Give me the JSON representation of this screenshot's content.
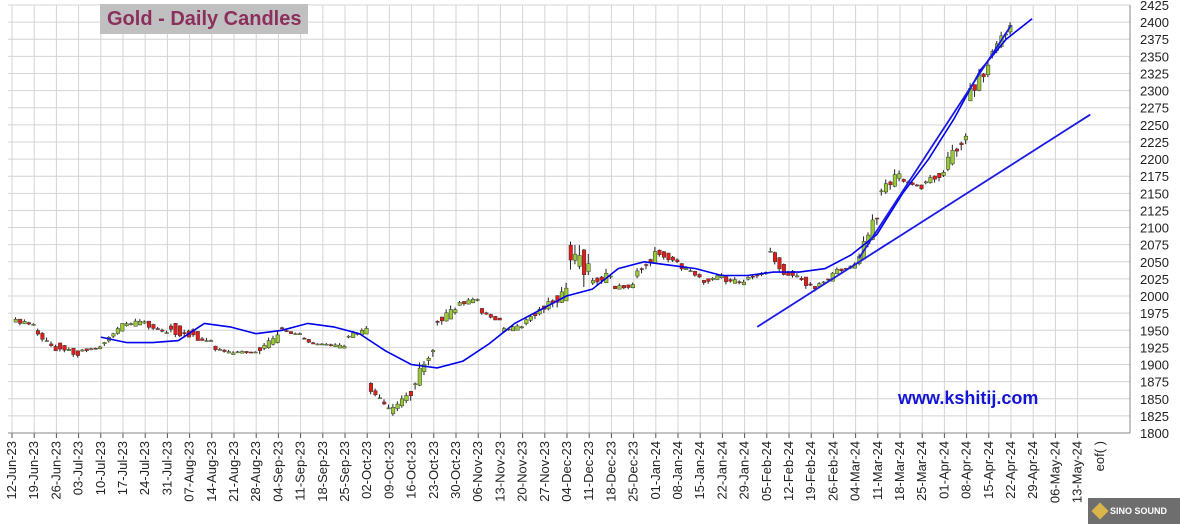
{
  "title": "Gold - Daily Candles",
  "watermark": "www.kshitij.com",
  "badge": "SINO SOUND",
  "eof_label": "eof( )",
  "colors": {
    "up": "#99cc33",
    "down": "#e41b17",
    "ma": "#0000ee",
    "trend": "#1a1ae6",
    "grid": "#d4d4d4"
  },
  "chart_data": {
    "type": "candlestick",
    "title": "Gold - Daily Candles",
    "ylim": [
      1800,
      2425
    ],
    "y_ticks": [
      1800,
      1825,
      1850,
      1875,
      1900,
      1925,
      1950,
      1975,
      2000,
      2025,
      2050,
      2075,
      2100,
      2125,
      2150,
      2175,
      2200,
      2225,
      2250,
      2275,
      2300,
      2325,
      2350,
      2375,
      2400,
      2425
    ],
    "x_ticks": [
      "12-Jun-23",
      "19-Jun-23",
      "26-Jun-23",
      "03-Jul-23",
      "10-Jul-23",
      "17-Jul-23",
      "24-Jul-23",
      "31-Jul-23",
      "07-Aug-23",
      "14-Aug-23",
      "21-Aug-23",
      "28-Aug-23",
      "04-Sep-23",
      "11-Sep-23",
      "18-Sep-23",
      "25-Sep-23",
      "02-Oct-23",
      "09-Oct-23",
      "16-Oct-23",
      "23-Oct-23",
      "30-Oct-23",
      "06-Nov-23",
      "13-Nov-23",
      "20-Nov-23",
      "27-Nov-23",
      "04-Dec-23",
      "11-Dec-23",
      "18-Dec-23",
      "25-Dec-23",
      "01-Jan-24",
      "08-Jan-24",
      "15-Jan-24",
      "22-Jan-24",
      "29-Jan-24",
      "05-Feb-24",
      "12-Feb-24",
      "19-Feb-24",
      "26-Feb-24",
      "04-Mar-24",
      "11-Mar-24",
      "18-Mar-24",
      "25-Mar-24",
      "01-Apr-24",
      "08-Apr-24",
      "15-Apr-24",
      "22-Apr-24",
      "29-Apr-24",
      "06-May-24",
      "13-May-24"
    ],
    "weekly_closes": [
      1958,
      1920,
      1915,
      1925,
      1958,
      1962,
      1945,
      1942,
      1920,
      1915,
      1918,
      1940,
      1935,
      1922,
      1925,
      1950,
      1833,
      1860,
      1925,
      1980,
      1995,
      1962,
      1955,
      1985,
      2005,
      2040,
      2030,
      2015,
      2060,
      2050,
      2028,
      2030,
      2018,
      2035,
      2025,
      2015,
      2030,
      2045,
      2120,
      2178,
      2158,
      2180,
      2235,
      2335,
      2395
    ],
    "weekly_highs": [
      1975,
      1965,
      1935,
      1930,
      1960,
      1985,
      1968,
      2005,
      1975,
      1935,
      1925,
      1965,
      1960,
      1945,
      1945,
      1960,
      1875,
      1890,
      1930,
      2000,
      2010,
      1985,
      1960,
      1990,
      2040,
      2150,
      2050,
      2040,
      2080,
      2075,
      2050,
      2040,
      2045,
      2055,
      2075,
      2040,
      2035,
      2050,
      2120,
      2205,
      2175,
      2200,
      2265,
      2365,
      2410
    ],
    "weekly_lows": [
      1950,
      1920,
      1905,
      1910,
      1925,
      1955,
      1940,
      1940,
      1935,
      1910,
      1910,
      1915,
      1945,
      1930,
      1920,
      1930,
      1830,
      1825,
      1850,
      1950,
      1985,
      1965,
      1935,
      1945,
      1975,
      1990,
      1995,
      2010,
      2020,
      2040,
      2025,
      2010,
      2010,
      2020,
      2030,
      2000,
      2000,
      2025,
      2045,
      2130,
      2155,
      2155,
      2180,
      2285,
      2340
    ],
    "weekly_opens": [
      1965,
      1950,
      1928,
      1920,
      1928,
      1958,
      1960,
      1955,
      1950,
      1925,
      1918,
      1920,
      1955,
      1940,
      1930,
      1940,
      1870,
      1830,
      1865,
      1960,
      1988,
      1980,
      1950,
      1960,
      1985,
      2065,
      2020,
      2012,
      2030,
      2065,
      2045,
      2020,
      2025,
      2025,
      2070,
      2035,
      2010,
      2035,
      2045,
      2150,
      2170,
      2165,
      2190,
      2290,
      2350
    ],
    "moving_average": [
      1940,
      1932,
      1932,
      1935,
      1960,
      1955,
      1945,
      1950,
      1960,
      1955,
      1945,
      1920,
      1900,
      1895,
      1905,
      1930,
      1960,
      1980,
      2000,
      2010,
      2040,
      2050,
      2045,
      2040,
      2030,
      2030,
      2035,
      2035,
      2040,
      2060,
      2090,
      2150,
      2200,
      2260,
      2330,
      2375,
      2405
    ],
    "trendlines": [
      {
        "from": [
          "02-Feb-24",
          1955
        ],
        "to": [
          "17-May-24",
          2265
        ]
      },
      {
        "from": [
          "05-Mar-24",
          2055
        ],
        "to": [
          "22-Apr-24",
          2395
        ]
      }
    ]
  }
}
